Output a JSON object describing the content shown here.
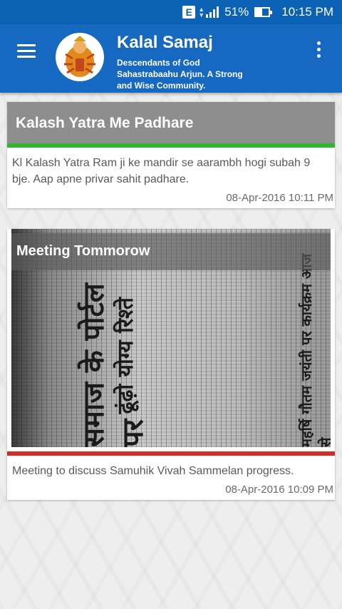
{
  "status_bar": {
    "network_badge": "E",
    "battery_percent": "51%",
    "battery_level": 0.51,
    "time": "10:15 PM"
  },
  "app_bar": {
    "title": "Kalal Samaj",
    "subtitle": "Descendants of God Sahastrabaahu Arjun. A Strong and Wise Community.",
    "menu_icon": "hamburger-menu-icon",
    "more_icon": "more-vert-icon"
  },
  "posts": [
    {
      "title": "Kalash Yatra Me Padhare",
      "body": "Kl Kalash Yatra Ram ji ke mandir se aarambh hogi subah 9 bje. Aap apne privar sahit padhare.",
      "date": "08-Apr-2016 10:11 PM",
      "accent_color": "#2fb52f"
    },
    {
      "title": "Meeting Tommorow",
      "body": "Meeting to discuss Samuhik Vivah Sammelan progress.",
      "date": "08-Apr-2016 10:09 PM",
      "accent_color": "#d42a2a",
      "image": {
        "headline_1": "समाज के पोर्टल पर",
        "headline_2": "ढूंढ़ो योग्य रिश्ते",
        "headline_3": "महर्षि गौतम जयंती पर कार्यक्रम आज से"
      }
    }
  ]
}
